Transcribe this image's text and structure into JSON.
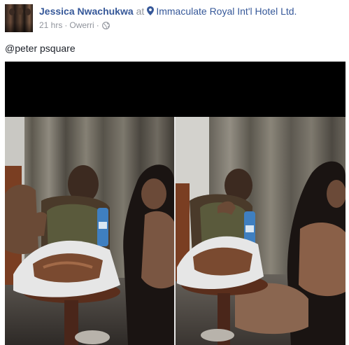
{
  "post": {
    "author": "Jessica Nwachukwa",
    "at_word": "at",
    "location": "Immaculate Royal Int'l Hotel Ltd.",
    "time": "21 hrs",
    "separator": "·",
    "city": "Owerri",
    "privacy_icon": "globe-icon",
    "message": "@peter psquare"
  },
  "icons": {
    "location": "map-pin-icon",
    "privacy": "globe-icon"
  },
  "colors": {
    "link": "#365899",
    "meta": "#90949c",
    "text": "#1d2129",
    "photo_background": "#000000"
  },
  "photo": {
    "description_layout": "two-panel collage"
  }
}
